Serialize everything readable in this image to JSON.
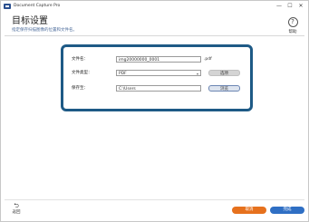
{
  "window": {
    "title": "Document Capture Pro",
    "controls": [
      "—",
      "☐",
      "✕"
    ]
  },
  "header": {
    "title": "目标设置",
    "subtitle": "指定保存扫描图像的位置和文件名。",
    "help_label": "帮助"
  },
  "settings": {
    "filename_label": "文件名：",
    "filename_value": "img20000000_0001",
    "filename_ext": ".pdf",
    "filetype_label": "文件类型：",
    "filetype_value": "PDF",
    "filetype_button": "选项",
    "folder_label": "保存至：",
    "folder_value": "C:\\Users",
    "folder_button": "浏览"
  },
  "footer": {
    "back_label": "返回",
    "cancel_label": "取消",
    "finish_label": "完成"
  },
  "colors": {
    "panel_border": "#1e5a86",
    "cancel": "#e6711d",
    "finish": "#2f6fc4"
  }
}
